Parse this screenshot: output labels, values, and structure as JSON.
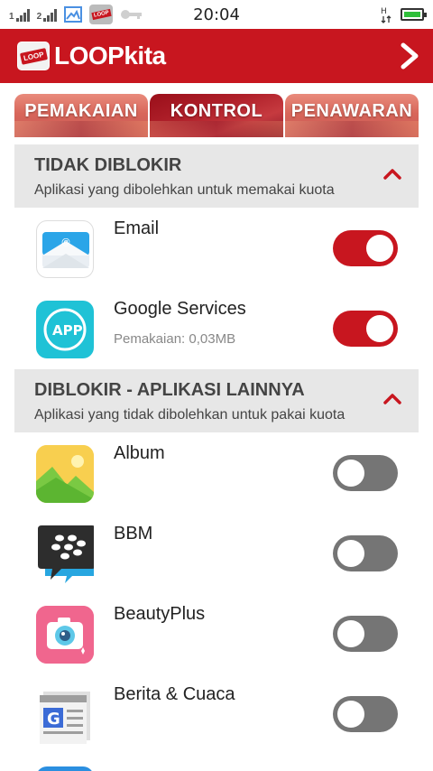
{
  "status_bar": {
    "time": "20:04",
    "network_label": "H",
    "icons": [
      "signal-icon",
      "signal-icon",
      "image-icon",
      "loopkita-notification-icon",
      "key-icon",
      "network-type-icon",
      "battery-icon"
    ]
  },
  "app_bar": {
    "title": "LOOPkita",
    "logo_text": "LOOP",
    "next_icon": "chevron-right-icon"
  },
  "tabs": [
    {
      "label": "PEMAKAIAN",
      "active": false
    },
    {
      "label": "KONTROL",
      "active": true
    },
    {
      "label": "PENAWARAN",
      "active": false
    }
  ],
  "sections": [
    {
      "title": "TIDAK DIBLOKIR",
      "subtitle": "Aplikasi yang dibolehkan untuk memakai kuota",
      "apps": [
        {
          "name": "Email",
          "meta": "",
          "enabled": true
        },
        {
          "name": "Google Services",
          "meta": "Pemakaian: 0,03MB",
          "enabled": true
        }
      ]
    },
    {
      "title": "DIBLOKIR - APLIKASI LAINNYA",
      "subtitle": "Aplikasi yang tidak dibolehkan untuk pakai kuota",
      "apps": [
        {
          "name": "Album",
          "meta": "",
          "enabled": false
        },
        {
          "name": "BBM",
          "meta": "",
          "enabled": false
        },
        {
          "name": "BeautyPlus",
          "meta": "",
          "enabled": false
        },
        {
          "name": "Berita & Cuaca",
          "meta": "",
          "enabled": false
        }
      ]
    }
  ],
  "colors": {
    "brand_red": "#c8161f",
    "toggle_off": "#757575",
    "section_bg": "#e7e7e7"
  }
}
